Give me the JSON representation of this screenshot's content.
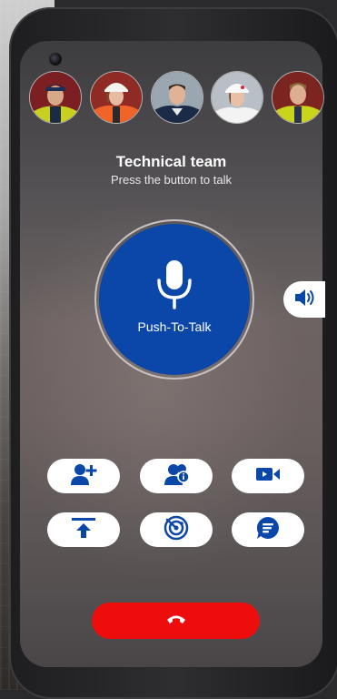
{
  "app": {
    "title": "Technical team",
    "subtitle": "Press the button to talk"
  },
  "participants": [
    {
      "name": "participant-1",
      "icon": "avatar-hardhat-man"
    },
    {
      "name": "participant-2",
      "icon": "avatar-hardhat-woman"
    },
    {
      "name": "participant-3",
      "icon": "avatar-man"
    },
    {
      "name": "participant-4",
      "icon": "avatar-hardhat-woman-white"
    },
    {
      "name": "participant-5",
      "icon": "avatar-man-vest"
    }
  ],
  "ptt": {
    "label": "Push-To-Talk",
    "icon": "microphone-icon"
  },
  "actions": [
    {
      "icon": "add-user-icon"
    },
    {
      "icon": "group-info-icon"
    },
    {
      "icon": "video-call-icon"
    },
    {
      "icon": "upload-icon"
    },
    {
      "icon": "radar-icon"
    },
    {
      "icon": "chat-icon"
    }
  ],
  "colors": {
    "accent": "#0a47a8",
    "danger": "#ee0d0d",
    "pill": "#ffffff"
  }
}
